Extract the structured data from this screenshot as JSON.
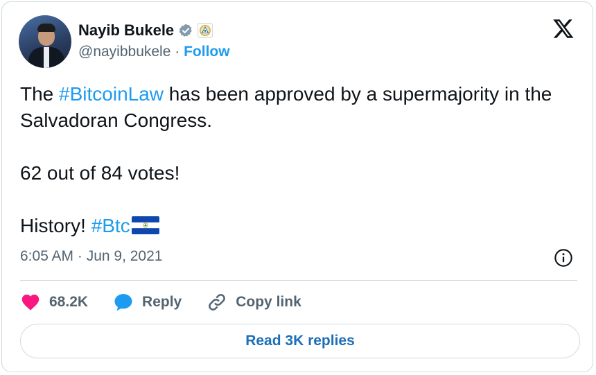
{
  "author": {
    "name": "Nayib Bukele",
    "handle": "@nayibbukele",
    "separator": "·",
    "follow_label": "Follow"
  },
  "tweet": {
    "text_pre": "The ",
    "hashtag_1": "#BitcoinLaw",
    "text_mid": " has been approved by a supermajority in the Salvadoran Congress.\n\n62 out of 84 votes!\n\nHistory! ",
    "hashtag_2": "#Btc",
    "timestamp": "6:05 AM · Jun 9, 2021"
  },
  "actions": {
    "likes": "68.2K",
    "reply_label": "Reply",
    "copy_link_label": "Copy link"
  },
  "read_replies_label": "Read 3K replies",
  "icons": {
    "verified": "verified-badge-icon",
    "government": "government-seal-icon",
    "logo": "x-logo-icon",
    "info": "info-icon",
    "like": "heart-icon",
    "reply": "speech-bubble-icon",
    "copy_link": "link-icon",
    "flag": "el-salvador-flag-icon"
  },
  "colors": {
    "accent": "#1d9bf0",
    "like": "#f91880",
    "text": "#0f1419",
    "muted": "#536471",
    "border": "#cfd9de"
  }
}
